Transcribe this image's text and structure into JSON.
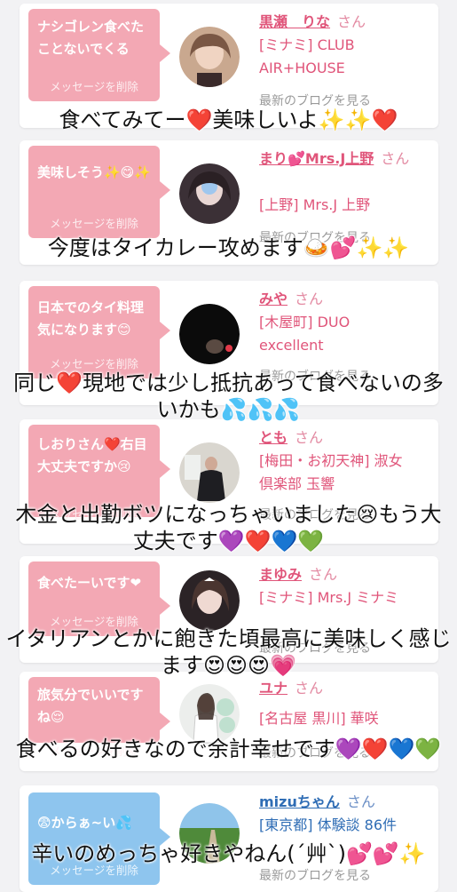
{
  "delete_label": "メッセージを削除",
  "blog_label": "最新のブログを見る",
  "san_label": "さん",
  "colors": {
    "accent_pink": "#f3a8b4",
    "accent_blue": "#8ec5ee",
    "name_pink": "#e0557a",
    "name_blue": "#2f6db5"
  },
  "cards": [
    {
      "message": "ナシゴレン食べたことないでくる",
      "name": "黒瀬　りな",
      "shop_lines": [
        "[ミナミ] CLUB",
        "AIR+HOUSE"
      ],
      "overlay": "食べてみてー❤️美味しいよ✨✨❤️"
    },
    {
      "message": "美味しそう✨😋✨",
      "name": "まり💕Mrs.J上野",
      "shop_lines": [
        "[上野] Mrs.J 上野"
      ],
      "overlay": "今度はタイカレー攻めます🍛💕✨✨"
    },
    {
      "message": "日本でのタイ料理気になります😊",
      "name": "みや",
      "shop_lines": [
        "[木屋町] DUO",
        "excellent"
      ],
      "overlay": "同じ❤️現地では少し抵抗あって食べないの多いかも💦💦💦"
    },
    {
      "message": "しおりさん❤️右目大丈夫ですか😢",
      "name": "とも",
      "shop_lines": [
        "[梅田・お初天神] 淑女",
        "倶楽部 玉響"
      ],
      "overlay": "木金と出勤ボツになっちゃいました😢もう大丈夫です💜❤️💙💚"
    },
    {
      "message": "食べたーいです❤",
      "name": "まゆみ",
      "shop_lines": [
        "[ミナミ] Mrs.J ミナミ"
      ],
      "overlay": "イタリアンとかに飽きた頃最高に美味しく感じます😍😍😍💗"
    },
    {
      "message": "旅気分でいいですね😌",
      "name": "ユナ",
      "shop_lines": [
        "[名古屋 黒川] 華咲"
      ],
      "overlay": "食べるの好きなので余計幸せです💜❤️💙💚"
    },
    {
      "message": "😨からぁ~い💦",
      "name": "mizuちゃん",
      "shop_lines": [
        "[東京都] 体験談 86件"
      ],
      "overlay": "辛いのめっちゃ好きやねん(´艸`)💕💕✨"
    }
  ]
}
